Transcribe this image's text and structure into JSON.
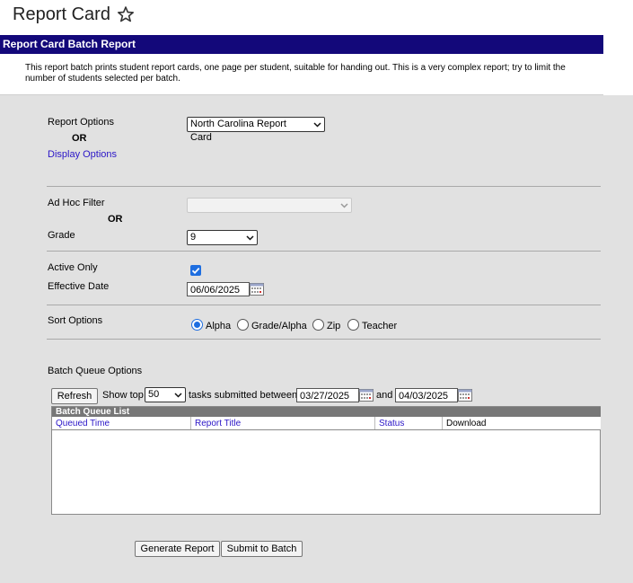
{
  "page": {
    "title": "Report Card"
  },
  "header": {
    "report_title": "Report Card Batch Report"
  },
  "description": "This report batch prints student report cards, one page per student, suitable for handing out. This is a very complex report; try to limit the number of students selected per batch.",
  "report_options": {
    "label": "Report Options",
    "selected": "North Carolina Report Card",
    "or_label": "OR",
    "display_options_link": "Display Options"
  },
  "filter": {
    "ad_hoc_label": "Ad Hoc Filter",
    "ad_hoc_value": "",
    "or_label": "OR",
    "grade_label": "Grade",
    "grade_value": "9"
  },
  "active_only": {
    "label": "Active Only",
    "checked": true
  },
  "effective_date": {
    "label": "Effective Date",
    "value": "06/06/2025"
  },
  "sort_options": {
    "label": "Sort Options",
    "options": [
      "Alpha",
      "Grade/Alpha",
      "Zip",
      "Teacher"
    ],
    "selected": "Alpha"
  },
  "batch_queue": {
    "label": "Batch Queue Options",
    "refresh_label": "Refresh",
    "show_top_label": "Show top",
    "show_top_value": "50",
    "tasks_between_label": "tasks submitted between",
    "start_date": "03/27/2025",
    "and_label": "and",
    "end_date": "04/03/2025",
    "list_title": "Batch Queue List",
    "columns": [
      "Queued Time",
      "Report Title",
      "Status",
      "Download"
    ]
  },
  "actions": {
    "generate_label": "Generate Report",
    "submit_label": "Submit to Batch"
  },
  "colors": {
    "header_band": "#13087a",
    "link": "#2a15c7",
    "form_bg": "#e1e1e1",
    "accent": "#1e6ee0"
  }
}
